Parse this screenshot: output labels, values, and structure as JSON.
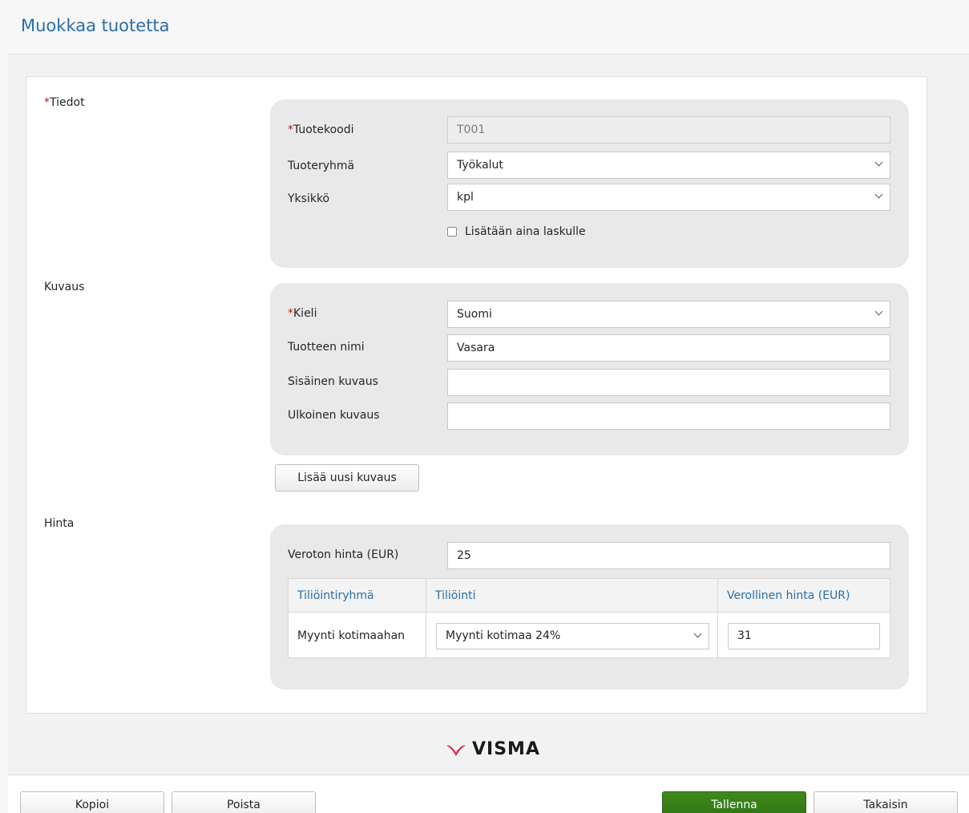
{
  "page": {
    "title": "Muokkaa tuotetta"
  },
  "tiedot": {
    "section_req": "*",
    "section_label": "Tiedot",
    "product_code": {
      "req": "*",
      "label": "Tuotekoodi",
      "value": "T001"
    },
    "product_group": {
      "label": "Tuoteryhmä",
      "value": "Työkalut"
    },
    "unit": {
      "label": "Yksikkö",
      "value": "kpl"
    },
    "always_add": {
      "label": "Lisätään aina laskulle",
      "checked": false
    }
  },
  "kuvaus": {
    "section_label": "Kuvaus",
    "language": {
      "req": "*",
      "label": "Kieli",
      "value": "Suomi"
    },
    "product_name": {
      "label": "Tuotteen nimi",
      "value": "Vasara"
    },
    "internal_desc": {
      "label": "Sisäinen kuvaus",
      "value": ""
    },
    "external_desc": {
      "label": "Ulkoinen kuvaus",
      "value": ""
    },
    "add_button": "Lisää uusi kuvaus"
  },
  "hinta": {
    "section_label": "Hinta",
    "net_price": {
      "label": "Veroton hinta (EUR)",
      "value": "25"
    },
    "table": {
      "headers": [
        "Tiliöintiryhmä",
        "Tiliöinti",
        "Verollinen hinta (EUR)"
      ],
      "rows": [
        {
          "group": "Myynti kotimaahan",
          "account": "Myynti kotimaa 24%",
          "gross": "31"
        }
      ]
    }
  },
  "logo": {
    "text": "VISMA",
    "color": "#d81f3a"
  },
  "footer": {
    "copy": "Kopioi",
    "delete": "Poista",
    "save": "Tallenna",
    "back": "Takaisin"
  },
  "colors": {
    "accent": "#2a6ea6",
    "primary_button": "#3a831a",
    "required": "#b51b1b"
  }
}
